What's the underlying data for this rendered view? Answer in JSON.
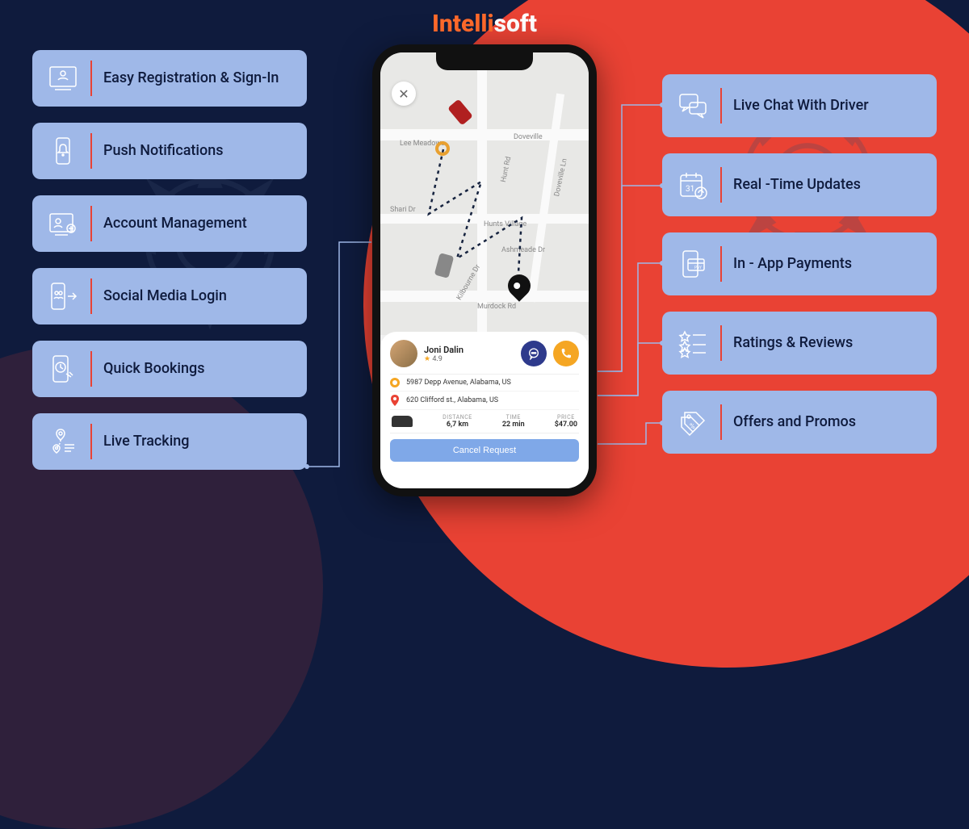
{
  "brand": {
    "part1": "Intelli",
    "part2": "soft"
  },
  "features_left": [
    {
      "label": "Easy Registration & Sign-In",
      "icon": "registration-icon"
    },
    {
      "label": "Push Notifications",
      "icon": "push-notification-icon"
    },
    {
      "label": "Account Management",
      "icon": "account-management-icon"
    },
    {
      "label": "Social Media Login",
      "icon": "social-login-icon"
    },
    {
      "label": "Quick Bookings",
      "icon": "quick-booking-icon"
    },
    {
      "label": "Live Tracking",
      "icon": "live-tracking-icon"
    }
  ],
  "features_right": [
    {
      "label": "Live Chat With Driver",
      "icon": "chat-icon"
    },
    {
      "label": "Real -Time Updates",
      "icon": "calendar-update-icon"
    },
    {
      "label": "In - App Payments",
      "icon": "payment-icon"
    },
    {
      "label": "Ratings & Reviews",
      "icon": "ratings-icon"
    },
    {
      "label": "Offers and Promos",
      "icon": "promo-icon"
    }
  ],
  "phone": {
    "map_labels": {
      "lee_meadows": "Lee Meadows",
      "doveville": "Doveville",
      "shari": "Shari Dr",
      "hunt": "Hunt Rd",
      "doveville_ln": "Doveville Ln",
      "hunts_village": "Hunts Village",
      "ashmeade": "Ashmeade Dr",
      "kilbourne": "Kilbourne Dr",
      "murdock": "Murdock Rd"
    },
    "driver": {
      "name": "Joni Dalin",
      "rating": "4.9"
    },
    "pickup": "5987 Depp Avenue, Alabama, US",
    "destination": "620 Clifford st., Alabama, US",
    "stats": {
      "distance_label": "DISTANCE",
      "distance_value": "6,7 km",
      "time_label": "TIME",
      "time_value": "22 min",
      "price_label": "PRICE",
      "price_value": "$47.00"
    },
    "cancel": "Cancel Request"
  }
}
